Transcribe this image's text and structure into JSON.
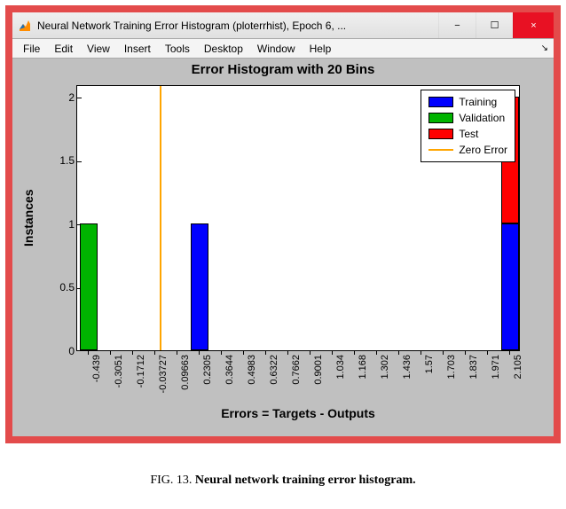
{
  "window": {
    "title": "Neural Network Training Error Histogram (ploterrhist), Epoch 6, ...",
    "min_label": "−",
    "max_label": "☐",
    "close_label": "×"
  },
  "menus": {
    "file": "File",
    "edit": "Edit",
    "view": "View",
    "insert": "Insert",
    "tools": "Tools",
    "desktop": "Desktop",
    "window": "Window",
    "help": "Help",
    "collapse": "↘"
  },
  "chart": {
    "title": "Error Histogram with 20 Bins",
    "xlabel": "Errors = Targets - Outputs",
    "ylabel": "Instances"
  },
  "legend": {
    "training": "Training",
    "validation": "Validation",
    "test": "Test",
    "zero": "Zero Error"
  },
  "yticks": [
    "0",
    "0.5",
    "1",
    "1.5",
    "2"
  ],
  "xticks": [
    "-0.439",
    "-0.3051",
    "-0.1712",
    "-0.03727",
    "0.09663",
    "0.2305",
    "0.3644",
    "0.4983",
    "0.6322",
    "0.7662",
    "0.9001",
    "1.034",
    "1.168",
    "1.302",
    "1.436",
    "1.57",
    "1.703",
    "1.837",
    "1.971",
    "2.105"
  ],
  "caption": "FIG. 13. Neural network training error histogram.",
  "chart_data": {
    "type": "bar",
    "stacked": true,
    "title": "Error Histogram with 20 Bins",
    "xlabel": "Errors = Targets - Outputs",
    "ylabel": "Instances",
    "ylim": [
      0,
      2.1
    ],
    "categories": [
      "-0.439",
      "-0.3051",
      "-0.1712",
      "-0.03727",
      "0.09663",
      "0.2305",
      "0.3644",
      "0.4983",
      "0.6322",
      "0.7662",
      "0.9001",
      "1.034",
      "1.168",
      "1.302",
      "1.436",
      "1.57",
      "1.703",
      "1.837",
      "1.971",
      "2.105"
    ],
    "series": [
      {
        "name": "Training",
        "color": "#0000ff",
        "values": [
          0,
          0,
          0,
          0,
          0,
          1,
          0,
          0,
          0,
          0,
          0,
          0,
          0,
          0,
          0,
          0,
          0,
          0,
          0,
          1
        ]
      },
      {
        "name": "Validation",
        "color": "#00b400",
        "values": [
          1,
          0,
          0,
          0,
          0,
          0,
          0,
          0,
          0,
          0,
          0,
          0,
          0,
          0,
          0,
          0,
          0,
          0,
          0,
          0
        ]
      },
      {
        "name": "Test",
        "color": "#ff0000",
        "values": [
          0,
          0,
          0,
          0,
          0,
          0,
          0,
          0,
          0,
          0,
          0,
          0,
          0,
          0,
          0,
          0,
          0,
          0,
          0,
          1
        ]
      }
    ],
    "zero_error_at": 0,
    "legend_position": "upper right"
  }
}
